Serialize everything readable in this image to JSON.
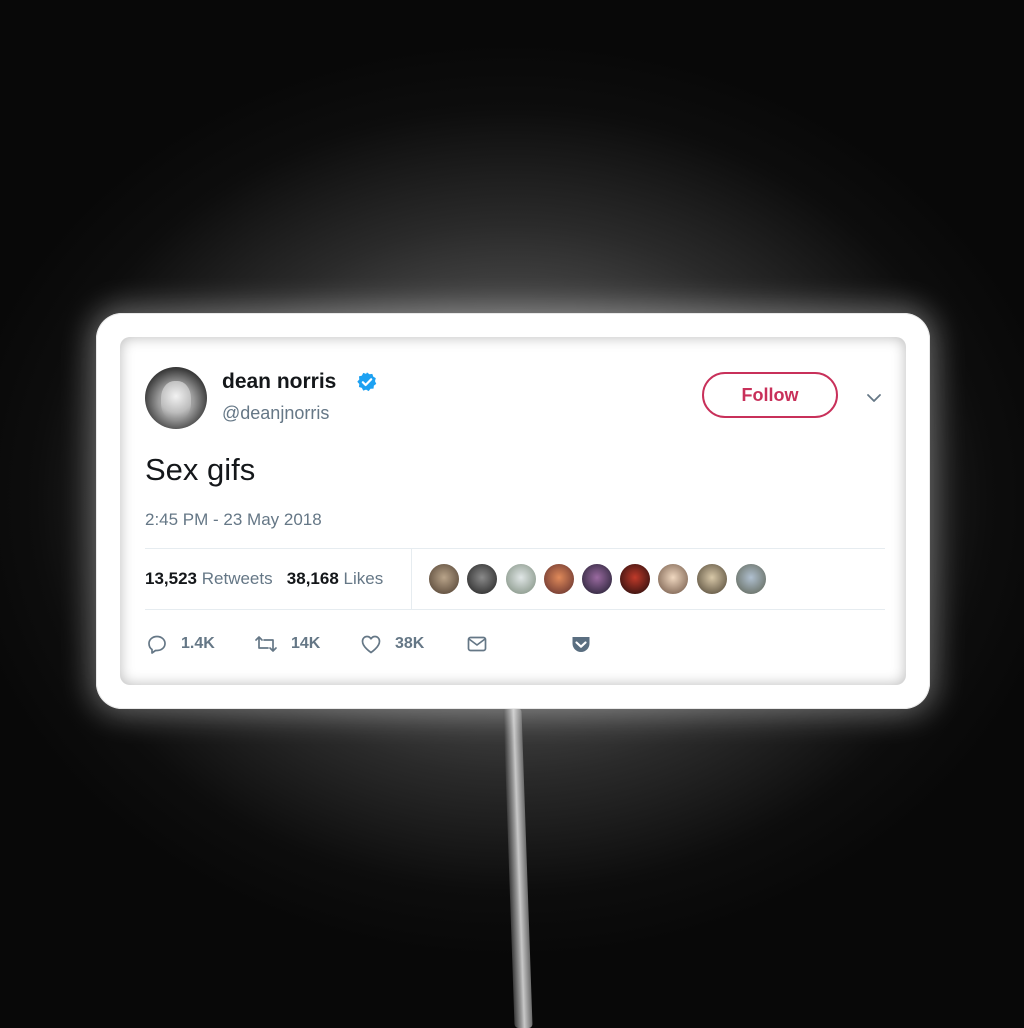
{
  "tweet": {
    "display_name": "dean norris",
    "handle": "@deanjnorris",
    "follow_label": "Follow",
    "text": "Sex gifs",
    "timestamp": "2:45 PM - 23 May 2018",
    "retweets_count": "13,523",
    "retweets_label": "Retweets",
    "likes_count": "38,168",
    "likes_label": "Likes",
    "actions": {
      "reply_count": "1.4K",
      "retweet_count": "14K",
      "like_count": "38K"
    }
  },
  "colors": {
    "follow_accent": "#c8305a",
    "verified_badge": "#1da1f2",
    "secondary_text": "#657786",
    "primary_text": "#14171a"
  },
  "icons": [
    "verified-badge-icon",
    "chevron-down-icon",
    "reply-icon",
    "retweet-icon",
    "like-icon",
    "message-icon",
    "pocket-icon"
  ]
}
